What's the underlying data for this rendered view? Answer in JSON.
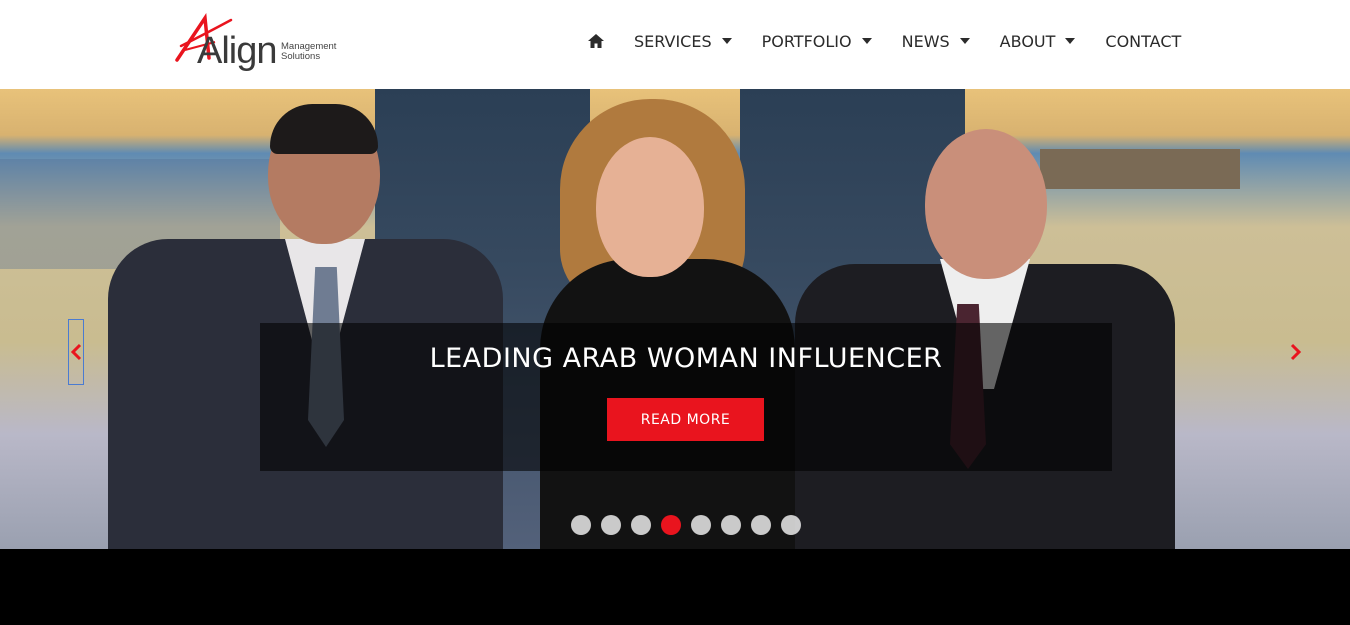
{
  "brand": {
    "logo_word": "Align",
    "logo_sub_1": "Management",
    "logo_sub_2": "Solutions",
    "accent": "#e9141e"
  },
  "nav": {
    "home_icon": "home-icon",
    "items": [
      {
        "label": "SERVICES",
        "dropdown": true
      },
      {
        "label": "PORTFOLIO",
        "dropdown": true
      },
      {
        "label": "NEWS",
        "dropdown": true
      },
      {
        "label": "ABOUT",
        "dropdown": true
      },
      {
        "label": "CONTACT",
        "dropdown": false
      }
    ]
  },
  "hero": {
    "title": "LEADING ARAB WOMAN INFLUENCER",
    "cta": "READ MORE",
    "slide_count": 8,
    "active_slide": 4
  }
}
